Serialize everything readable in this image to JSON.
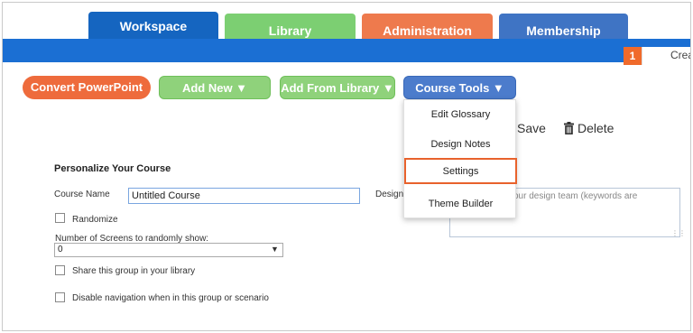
{
  "tabs": [
    {
      "label": "Workspace",
      "color": "#1565c0",
      "active": true
    },
    {
      "label": "Library",
      "color": "#7ccf72"
    },
    {
      "label": "Administration",
      "color": "#ee7a4d"
    },
    {
      "label": "Membership",
      "color": "#3f74c4"
    }
  ],
  "header": {
    "badge": "1",
    "create_label": "Creat"
  },
  "toolbar": {
    "convert_label": "Convert PowerPoint",
    "add_new_label": "Add New ▼",
    "add_from_library_label": "Add From Library ▼",
    "course_tools_label": "Course Tools ▼"
  },
  "actions": {
    "save_label": "Save",
    "delete_label": "Delete"
  },
  "course_tools_menu": {
    "items": [
      "Edit Glossary",
      "Design Notes",
      "Settings",
      "Theme Builder"
    ],
    "highlighted": "Settings"
  },
  "form": {
    "section_title": "Personalize Your Course",
    "course_name_label": "Course Name",
    "course_name_value": "Untitled Course",
    "design_label": "Design",
    "design_placeholder": "our design team (keywords are",
    "randomize_label": "Randomize",
    "screens_label": "Number of Screens to randomly show:",
    "screens_value": "0",
    "share_label": "Share this group in your library",
    "disable_nav_label": "Disable navigation when in this group or scenario"
  },
  "colors": {
    "accent_blue": "#1b6fd3",
    "orange": "#ee6b3c",
    "green": "#8fd27b",
    "menu_highlight": "#e8622c"
  }
}
